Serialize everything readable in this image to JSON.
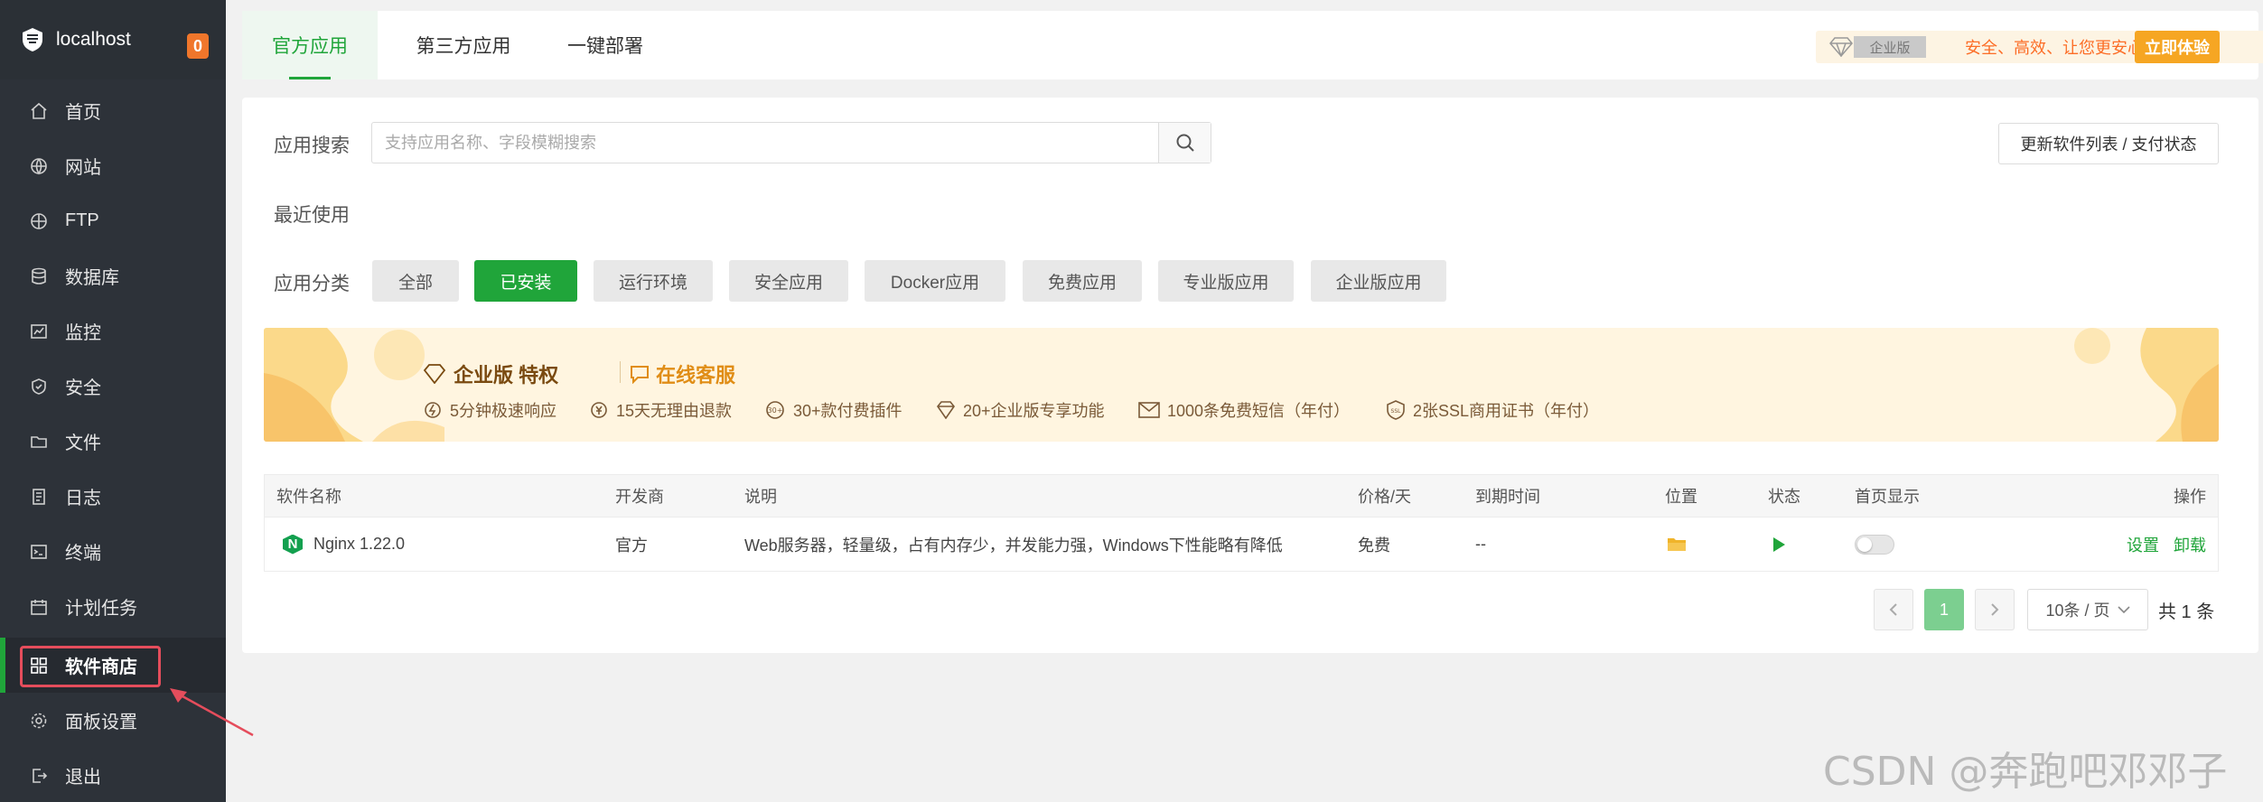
{
  "sidebar": {
    "host": "localhost",
    "badge": "0",
    "items": [
      {
        "label": "首页",
        "icon": "home-icon"
      },
      {
        "label": "网站",
        "icon": "globe-icon"
      },
      {
        "label": "FTP",
        "icon": "ftp-globe-icon"
      },
      {
        "label": "数据库",
        "icon": "database-icon"
      },
      {
        "label": "监控",
        "icon": "monitor-icon"
      },
      {
        "label": "安全",
        "icon": "shield-icon"
      },
      {
        "label": "文件",
        "icon": "folder-icon"
      },
      {
        "label": "日志",
        "icon": "log-icon"
      },
      {
        "label": "终端",
        "icon": "terminal-icon"
      },
      {
        "label": "计划任务",
        "icon": "calendar-icon"
      },
      {
        "label": "软件商店",
        "icon": "grid-icon"
      },
      {
        "label": "面板设置",
        "icon": "gear-icon"
      },
      {
        "label": "退出",
        "icon": "logout-icon"
      }
    ],
    "active_index": 10
  },
  "tabs": [
    {
      "label": "官方应用"
    },
    {
      "label": "第三方应用"
    },
    {
      "label": "一键部署"
    }
  ],
  "promo": {
    "tag": "企业版",
    "slogan": "安全、高效、让您更安心",
    "try_label": "立即体验"
  },
  "search": {
    "label": "应用搜索",
    "placeholder": "支持应用名称、字段模糊搜索",
    "value": "",
    "update_label": "更新软件列表 / 支付状态"
  },
  "recent_label": "最近使用",
  "category": {
    "label": "应用分类",
    "items": [
      "全部",
      "已安装",
      "运行环境",
      "安全应用",
      "Docker应用",
      "免费应用",
      "专业版应用",
      "企业版应用"
    ],
    "active": "已安装"
  },
  "banner": {
    "title1": "企业版 特权",
    "title2": "在线客服",
    "features": [
      "5分钟极速响应",
      "15天无理由退款",
      "30+款付费插件",
      "20+企业版专享功能",
      "1000条免费短信（年付）",
      "2张SSL商用证书（年付）"
    ]
  },
  "table": {
    "headers": [
      "软件名称",
      "开发商",
      "说明",
      "价格/天",
      "到期时间",
      "位置",
      "状态",
      "首页显示",
      "操作"
    ],
    "rows": [
      {
        "name": "Nginx 1.22.0",
        "vendor": "官方",
        "desc": "Web服务器，轻量级，占有内存少，并发能力强，Windows下性能略有降低",
        "price": "免费",
        "expire": "--",
        "home_display": false,
        "action_settings": "设置",
        "action_uninstall": "卸载"
      }
    ]
  },
  "pagination": {
    "current": "1",
    "page_size": "10条 / 页",
    "total": "共 1 条"
  },
  "watermark": "CSDN @奔跑吧邓邓子",
  "colors": {
    "sidebar_bg": "#2d3239",
    "accent": "#20a53a",
    "badge": "#f0762b",
    "promo_orange": "#fc6d26",
    "highlight_box": "#e54d5c"
  }
}
